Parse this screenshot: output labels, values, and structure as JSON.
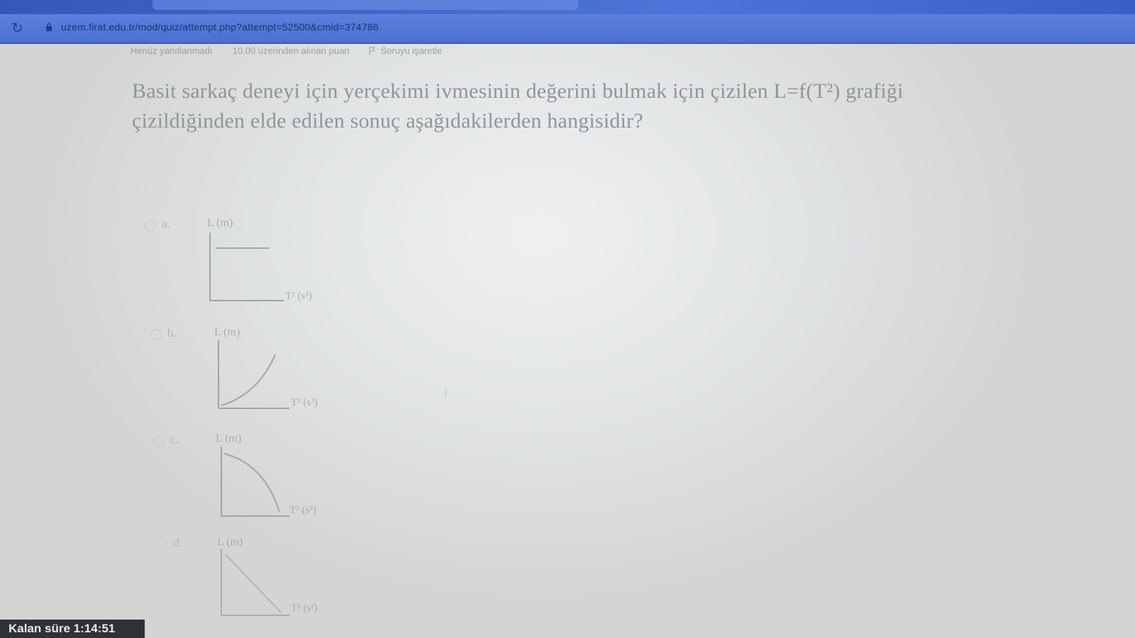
{
  "browser": {
    "url": "uzem.firat.edu.tr/mod/quiz/attempt.php?attempt=52500&cmid=374786"
  },
  "quiz_info": {
    "status": "Henüz yanıtlanmadı",
    "points": "10,00 üzerinden alınan puan",
    "flag": "Soruyu işaretle"
  },
  "question": {
    "line1": "Basit sarkaç deneyi için yerçekimi ivmesinin değerini bulmak için çizilen L=f(T²) grafiği",
    "line2": "çizildiğinden elde edilen sonuç aşağıdakilerden hangisidir?"
  },
  "options": [
    {
      "letter": "a.",
      "y_label": "L (m)",
      "x_label": "T² (s²)",
      "curve": "horizontal-line"
    },
    {
      "letter": "b.",
      "y_label": "L (m)",
      "x_label": "T² (s²)",
      "curve": "increasing-concave-up"
    },
    {
      "letter": "c.",
      "y_label": "L (m)",
      "x_label": "T² (s²)",
      "curve": "decreasing-concave-down"
    },
    {
      "letter": "d.",
      "y_label": "L (m)",
      "x_label": "T² (s²)",
      "curve": "decreasing-line"
    }
  ],
  "timer": {
    "label": "Kalan süre 1:14:51"
  }
}
